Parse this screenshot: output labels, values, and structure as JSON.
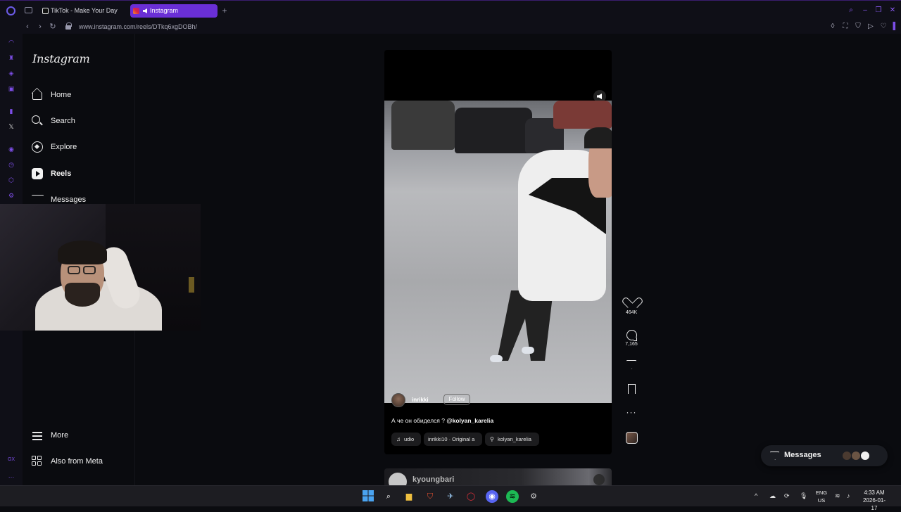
{
  "browser": {
    "tabs": [
      {
        "label": "TikTok - Make Your Day",
        "active": false
      },
      {
        "label": "Instagram",
        "active": true
      }
    ],
    "url": "www.instagram.com/reels/DTkq6xgDOBh/",
    "accent": "#6a2fd6"
  },
  "sidebar": {
    "logo": "Instagram",
    "items": [
      {
        "label": "Home",
        "icon": "home-icon"
      },
      {
        "label": "Search",
        "icon": "search-icon"
      },
      {
        "label": "Explore",
        "icon": "explore-icon"
      },
      {
        "label": "Reels",
        "icon": "reels-icon",
        "active": true
      },
      {
        "label": "Messages",
        "icon": "messages-icon"
      }
    ],
    "bottom": [
      {
        "label": "More",
        "icon": "hamburger-icon"
      },
      {
        "label": "Also from Meta",
        "icon": "meta-grid-icon"
      }
    ]
  },
  "reel": {
    "username": "inrikki",
    "follow_label": "Follow",
    "caption_text": "А че он обиделся ? ",
    "caption_mention": "@kolyan_karelia",
    "chips": [
      {
        "icon": "music-icon",
        "label": "udio"
      },
      {
        "icon": "",
        "label": "inrikki10 · Original a"
      },
      {
        "icon": "person-icon",
        "label": "kolyan_karelia"
      }
    ],
    "likes": "464K",
    "comments": "7,165",
    "next_username": "kyoungbari"
  },
  "messages_pill": {
    "label": "Messages"
  },
  "taskbar": {
    "lang_top": "ENG",
    "lang_bottom": "US",
    "time": "4:33 AM",
    "date": "2026-01-17"
  }
}
